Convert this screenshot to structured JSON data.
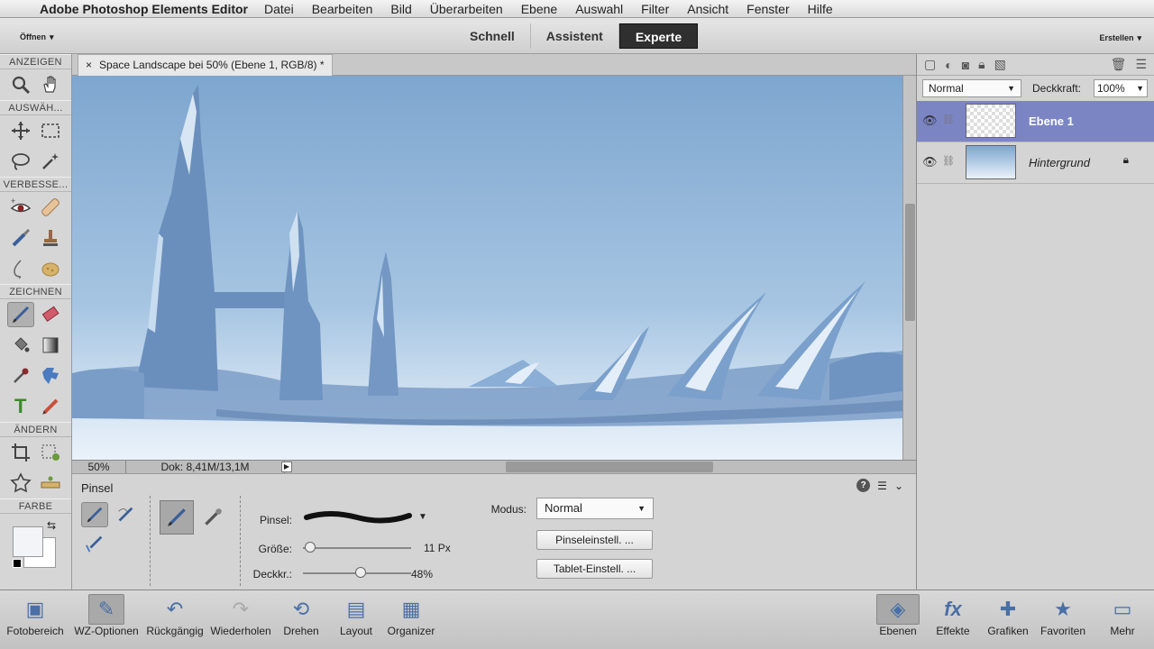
{
  "menubar": {
    "app_name": "Adobe Photoshop Elements Editor",
    "items": [
      "Datei",
      "Bearbeiten",
      "Bild",
      "Überarbeiten",
      "Ebene",
      "Auswahl",
      "Filter",
      "Ansicht",
      "Fenster",
      "Hilfe"
    ]
  },
  "topbar": {
    "open_label": "Öffnen",
    "modes": [
      "Schnell",
      "Assistent",
      "Experte"
    ],
    "active_mode": "Experte",
    "create_label": "Erstellen"
  },
  "toolbox": {
    "sections": [
      "ANZEIGEN",
      "AUSWÄH...",
      "VERBESSE...",
      "ZEICHNEN",
      "ÄNDERN",
      "FARBE"
    ]
  },
  "document": {
    "tab_title": "Space Landscape bei 50% (Ebene 1, RGB/8) *",
    "close_glyph": "×",
    "zoom": "50%",
    "doc_info": "Dok: 8,41M/13,1M"
  },
  "tool_options": {
    "title": "Pinsel",
    "brush_label": "Pinsel:",
    "size_label": "Größe:",
    "size_value": "11 Px",
    "size_fraction": 0.02,
    "opacity_label": "Deckkr.:",
    "opacity_value": "48%",
    "opacity_fraction": 0.48,
    "mode_label": "Modus:",
    "mode_value": "Normal",
    "brush_settings_button": "Pinseleinstell. ...",
    "tablet_settings_button": "Tablet-Einstell. ..."
  },
  "layers_panel": {
    "blend_mode": "Normal",
    "opacity_label": "Deckkraft:",
    "opacity_value": "100%",
    "layers": [
      {
        "name": "Ebene 1",
        "active": true
      },
      {
        "name": "Hintergrund",
        "active": false
      }
    ]
  },
  "taskbar": {
    "left": [
      "Fotobereich",
      "WZ-Optionen",
      "Rückgängig",
      "Wiederholen",
      "Drehen",
      "Layout",
      "Organizer"
    ],
    "right": [
      "Ebenen",
      "Effekte",
      "Grafiken",
      "Favoriten",
      "Mehr"
    ]
  },
  "colors": {
    "accent_active_layer": "#7b85c4",
    "sky_top": "#86acd3",
    "sky_bottom": "#e6f0f9",
    "structures": "#6f94bf"
  }
}
